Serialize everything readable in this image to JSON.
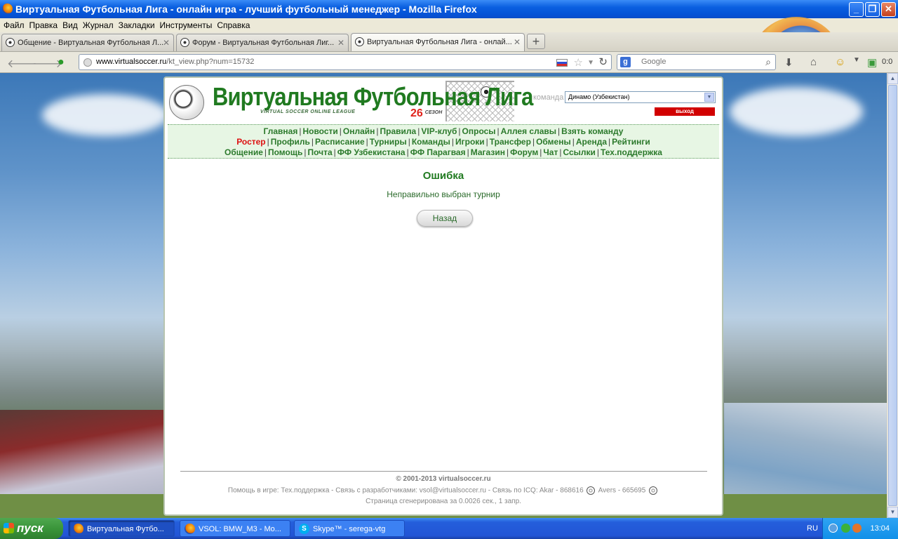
{
  "window": {
    "title": "Виртуальная Футбольная Лига - онлайн игра - лучший футбольный менеджер - Mozilla Firefox"
  },
  "menubar": [
    "Файл",
    "Правка",
    "Вид",
    "Журнал",
    "Закладки",
    "Инструменты",
    "Справка"
  ],
  "tabs": [
    {
      "label": "Общение - Виртуальная Футбольная Л...",
      "active": false
    },
    {
      "label": "Форум - Виртуальная Футбольная Лиг...",
      "active": false
    },
    {
      "label": "Виртуальная Футбольная Лига - онлай...",
      "active": true
    }
  ],
  "url": {
    "host": "www.virtualsoccer.ru",
    "path": "/kt_view.php?num=15732"
  },
  "search": {
    "placeholder": "Google"
  },
  "toolbar": {
    "counter": "0:0"
  },
  "site": {
    "logo_title": "Виртуальная Футбольная Лига",
    "logo_subtitle": "VIRTUAL SOCCER ONLINE LEAGUE",
    "season_number": "26",
    "season_label": "СЕЗОН",
    "team_label": "команда",
    "team_selected": "Динамо (Узбекистан)",
    "logout_label": "выход",
    "menu": {
      "row1": [
        "Главная",
        "Новости",
        "Онлайн",
        "Правила",
        "VIP-клуб",
        "Опросы",
        "Аллея славы",
        "Взять команду"
      ],
      "row2": [
        "Ростер",
        "Профиль",
        "Расписание",
        "Турниры",
        "Команды",
        "Игроки",
        "Трансфер",
        "Обмены",
        "Аренда",
        "Рейтинги"
      ],
      "row3": [
        "Общение",
        "Помощь",
        "Почта",
        "ФФ Узбекистана",
        "ФФ Парагвая",
        "Магазин",
        "Форум",
        "Чат",
        "Ссылки",
        "Тех.поддержка"
      ]
    },
    "error_title": "Ошибка",
    "error_message": "Неправильно выбран турнир",
    "back_button": "Назад",
    "footer": {
      "copyright": "© 2001-2013 virtualsoccer.ru",
      "help_prefix": "Помощь в игре: Тех.поддержка - Связь с разработчиками: vsol@virtualsoccer.ru - Связь по ICQ: Akar - 868616",
      "help_suffix": "Avers - 665695",
      "generated": "Страница сгенерирована за 0.0026 сек., 1 запр."
    }
  },
  "taskbar": {
    "start_label": "пуск",
    "tasks": [
      {
        "label": "Виртуальная Футбо...",
        "active": true
      },
      {
        "label": "VSOL: BMW_M3 - Mo...",
        "active": false
      },
      {
        "label": "Skype™ - serega-vtg",
        "active": false
      }
    ],
    "language": "RU",
    "clock": "13:04"
  }
}
